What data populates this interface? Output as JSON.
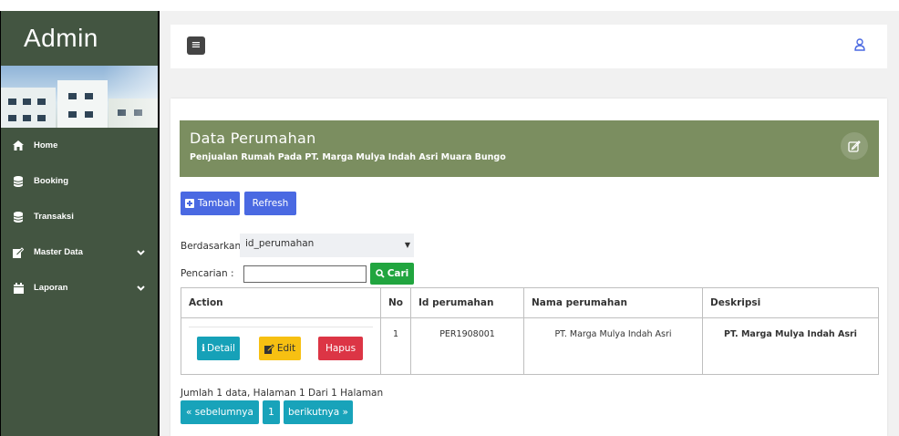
{
  "sidebar": {
    "title": "Admin",
    "items": [
      {
        "label": "Home",
        "icon": "home-icon"
      },
      {
        "label": "Booking",
        "icon": "database-icon"
      },
      {
        "label": "Transaksi",
        "icon": "database-icon"
      },
      {
        "label": "Master Data",
        "icon": "edit-icon",
        "expandable": true
      },
      {
        "label": "Laporan",
        "icon": "calendar-icon",
        "expandable": true
      }
    ]
  },
  "header": {
    "menu_icon": "hamburger-icon",
    "user_icon": "user-icon"
  },
  "panel": {
    "title": "Data Perumahan",
    "subtitle": "Penjualan Rumah Pada PT. Marga Mulya Indah Asri Muara Bungo",
    "add_label": "Tambah",
    "refresh_label": "Refresh",
    "filter_label": "Berdasarkan :",
    "filter_value": "id_perumahan",
    "search_label": "Pencarian    :",
    "search_value": "",
    "search_button": "Cari"
  },
  "table": {
    "headers": [
      "Action",
      "No",
      "Id perumahan",
      "Nama perumahan",
      "Deskripsi"
    ],
    "rows": [
      {
        "no": "1",
        "id": "PER1908001",
        "nama": "PT. Marga Mulya Indah Asri",
        "deskripsi": "PT. Marga Mulya Indah Asri",
        "actions": {
          "detail": "Detail",
          "edit": "Edit",
          "hapus": "Hapus"
        }
      }
    ]
  },
  "pagination": {
    "summary": "Jumlah 1 data, Halaman 1 Dari 1 Halaman",
    "prev": "« sebelumnya",
    "page": "1",
    "next": "berikutnya »"
  },
  "colors": {
    "sidebar": "#435541",
    "panel_header": "#7b8e60",
    "primary": "#4a69e2",
    "success": "#21a53f",
    "info": "#16a1b8",
    "warning": "#f7c012",
    "danger": "#dc3545"
  }
}
